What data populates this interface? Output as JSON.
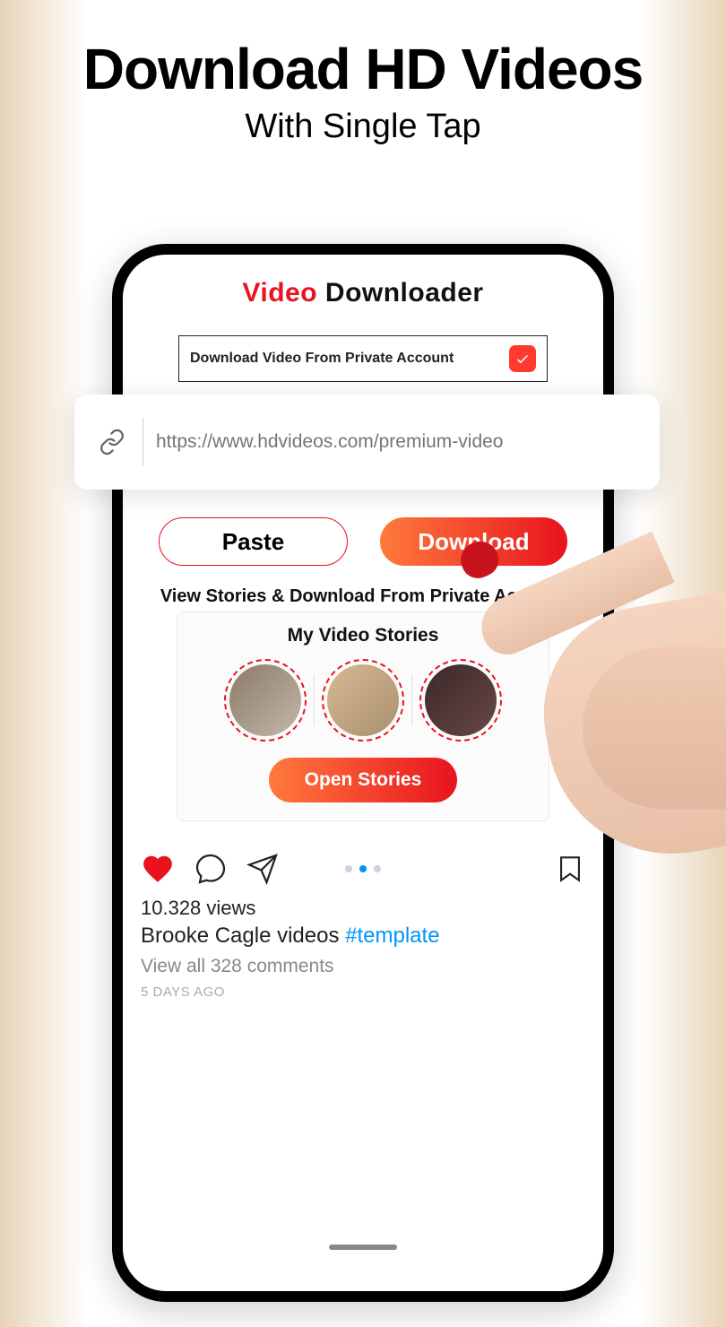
{
  "hero": {
    "title": "Download HD Videos",
    "subtitle": "With Single Tap"
  },
  "app": {
    "title_red": "Video",
    "title_dark": " Downloader",
    "private_label": "Download Video From Private Account",
    "url_placeholder": "https://www.hdvideos.com/premium-video",
    "paste": "Paste",
    "download": "Download",
    "section_label": "View Stories & Download From Private Account",
    "stories_title": "My Video Stories",
    "open_stories": "Open Stories"
  },
  "post": {
    "views": "10.328 views",
    "author": "Brooke Cagle videos ",
    "hashtag": "#template",
    "comments": "View all 328 comments",
    "time": "5 DAYS AGO"
  }
}
